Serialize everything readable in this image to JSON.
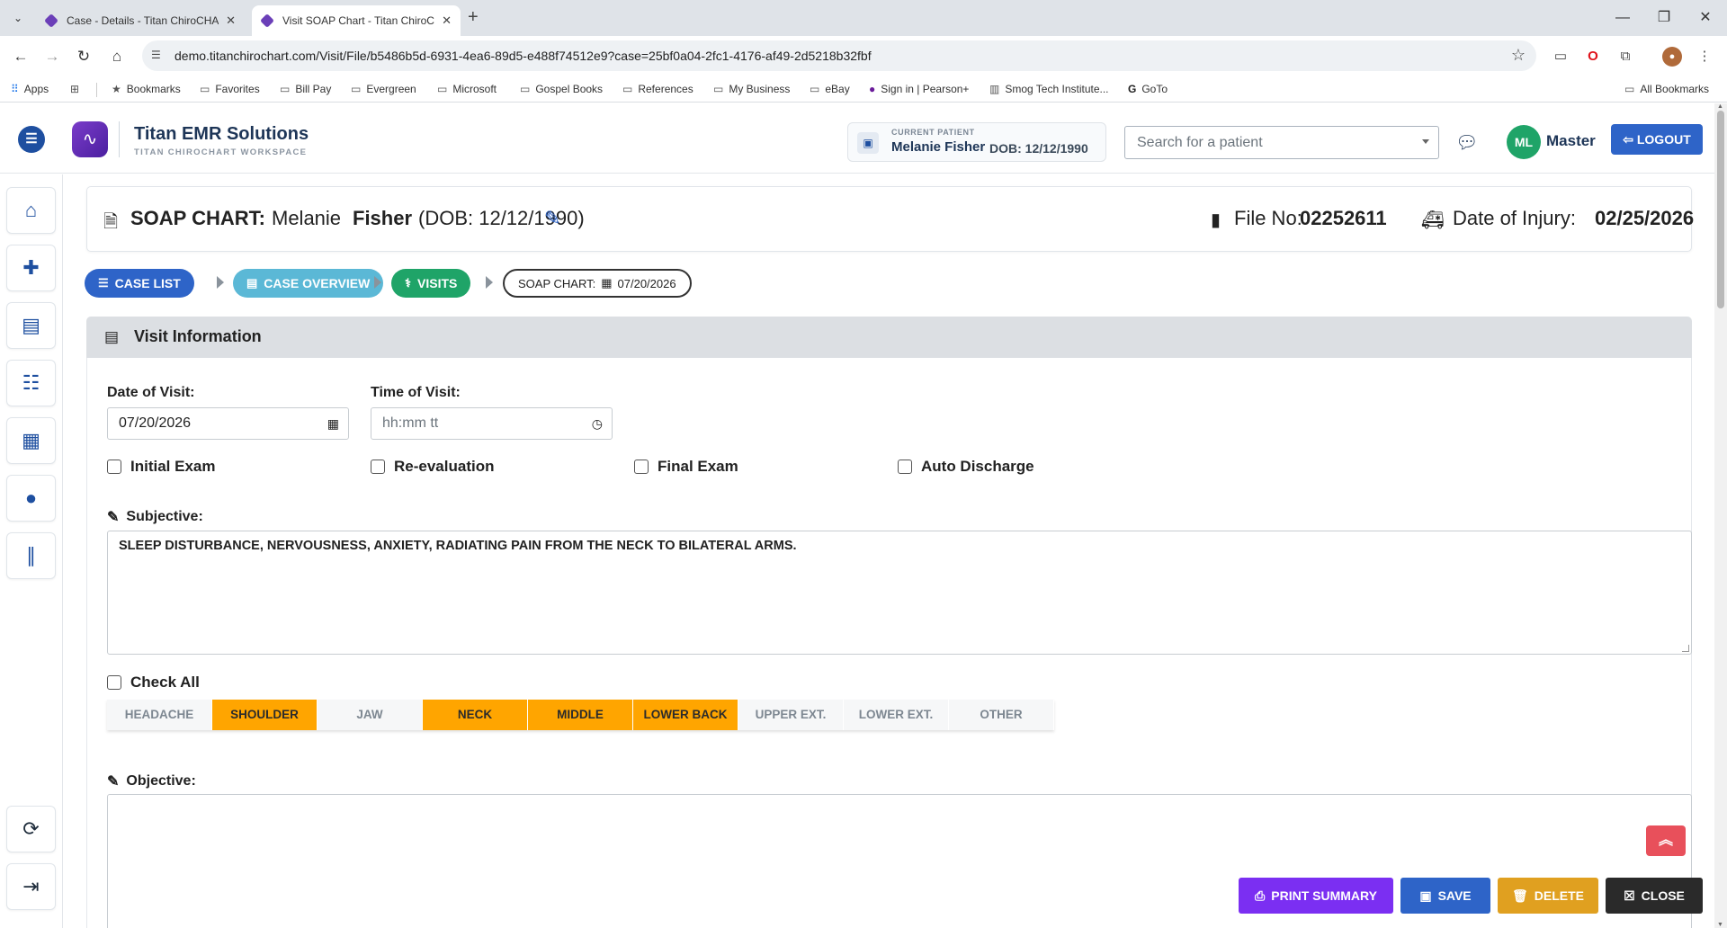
{
  "browser": {
    "tabs": [
      {
        "title": "Case - Details - Titan ChiroCHART",
        "active": false
      },
      {
        "title": "Visit SOAP Chart - Titan ChiroCHART",
        "active": true
      }
    ],
    "url": "demo.titanchirochart.com/Visit/File/b5486b5d-6931-4ea6-89d5-e488f74512e9?case=25bf0a04-2fc1-4176-af49-2d5218b32fbf",
    "bookmarks": [
      "Apps",
      "Bookmarks",
      "Favorites",
      "Bill Pay",
      "Evergreen",
      "Microsoft",
      "Gospel Books",
      "References",
      "My Business",
      "eBay",
      "Sign in | Pearson+",
      "Smog Tech Institute...",
      "GoTo"
    ],
    "all_bookmarks": "All Bookmarks"
  },
  "header": {
    "brand_name": "Titan EMR Solutions",
    "brand_sub": "TITAN CHIROCHART WORKSPACE",
    "current_patient_label": "CURRENT PATIENT",
    "current_patient_name": "Melanie Fisher",
    "current_patient_dob": "DOB: 12/12/1990",
    "search_placeholder": "Search for a patient",
    "user_initials": "ML",
    "user_name": "Master",
    "logout_label": "LOGOUT"
  },
  "sidebar": {
    "items": [
      {
        "name": "home-icon",
        "glyph": "⌂"
      },
      {
        "name": "medical-case-icon",
        "glyph": "✚"
      },
      {
        "name": "id-card-icon",
        "glyph": "▤"
      },
      {
        "name": "user-list-icon",
        "glyph": "☷"
      },
      {
        "name": "calendar-icon",
        "glyph": "▦"
      },
      {
        "name": "chat-icon",
        "glyph": "●"
      },
      {
        "name": "barcode-icon",
        "glyph": "∥"
      }
    ],
    "bottom": [
      {
        "name": "sync-icon",
        "glyph": "⟳"
      },
      {
        "name": "sign-out-icon",
        "glyph": "⇥"
      }
    ]
  },
  "soap": {
    "label": "SOAP CHART:",
    "first_name": "Melanie",
    "last_name": "Fisher",
    "dob": "(DOB: 12/12/1990)",
    "file_label": "File No:",
    "file_no": "02252611",
    "injury_label": "Date of Injury:",
    "injury_date": "02/25/2026"
  },
  "breadcrumbs": {
    "case_list": "CASE LIST",
    "case_overview": "CASE OVERVIEW",
    "visits": "VISITS",
    "soap_chart_label": "SOAP CHART:",
    "soap_chart_date": "07/20/2026"
  },
  "visit_info": {
    "title": "Visit Information",
    "date_label": "Date of Visit:",
    "date_value": "07/20/2026",
    "time_label": "Time of Visit:",
    "time_placeholder": "hh:mm tt",
    "checks": {
      "initial_exam": "Initial Exam",
      "re_evaluation": "Re-evaluation",
      "final_exam": "Final Exam",
      "auto_discharge": "Auto Discharge"
    },
    "subjective_label": "Subjective:",
    "subjective_text": "SLEEP DISTURBANCE, NERVOUSNESS, ANXIETY, RADIATING PAIN FROM THE NECK TO BILATERAL ARMS.",
    "check_all": "Check All",
    "regions": [
      {
        "label": "HEADACHE",
        "selected": false
      },
      {
        "label": "SHOULDER",
        "selected": true
      },
      {
        "label": "JAW",
        "selected": false
      },
      {
        "label": "NECK",
        "selected": true
      },
      {
        "label": "MIDDLE",
        "selected": true
      },
      {
        "label": "LOWER BACK",
        "selected": true
      },
      {
        "label": "UPPER EXT.",
        "selected": false
      },
      {
        "label": "LOWER EXT.",
        "selected": false
      },
      {
        "label": "OTHER",
        "selected": false
      }
    ],
    "objective_label": "Objective:",
    "objective_text": ""
  },
  "actions": {
    "print_summary": "PRINT SUMMARY",
    "save": "SAVE",
    "delete": "DELETE",
    "close": "CLOSE"
  },
  "colors": {
    "primary": "#2e64c8",
    "teal": "#5bb8d6",
    "green": "#1fa468",
    "region_selected": "#ffa500",
    "print": "#7b2ff2",
    "save": "#2e64c8",
    "delete": "#e0a020",
    "close": "#2a2a2a",
    "scroll_top": "#e8505b"
  }
}
